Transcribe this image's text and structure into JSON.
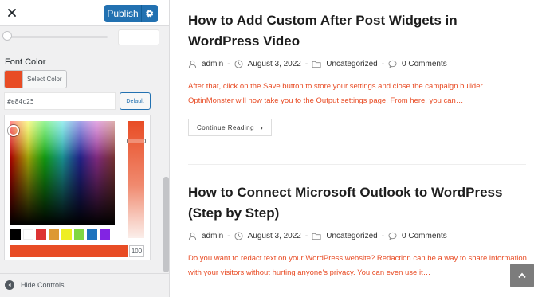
{
  "panel": {
    "publish_label": "Publish",
    "slider_value": "",
    "font_color": {
      "label": "Font Color",
      "select_label": "Select Color",
      "hex_value": "#e84c25",
      "default_label": "Default",
      "alpha_value": "100",
      "current_color": "#e84c25",
      "palettes": [
        "#000000",
        "#ffffff",
        "#dd3333",
        "#dd9933",
        "#eeee22",
        "#81d742",
        "#1e73be",
        "#8224e3"
      ]
    },
    "hide_controls_label": "Hide Controls"
  },
  "posts": [
    {
      "title": "How to Add Custom After Post Widgets in WordPress Video",
      "author": "admin",
      "date": "August 3, 2022",
      "category": "Uncategorized",
      "comments": "0 Comments",
      "excerpt": "After that, click on the Save button to store your settings and close the campaign builder. OptinMonster will now take you to the Output settings page. From here, you can…",
      "continue_label": "Continue Reading"
    },
    {
      "title": "How to Connect Microsoft Outlook to WordPress (Step by Step)",
      "author": "admin",
      "date": "August 3, 2022",
      "category": "Uncategorized",
      "comments": "0 Comments",
      "excerpt": "Do you want to redact text on your WordPress website? Redaction can be a way to share information with your visitors without hurting anyone's privacy. You can even use it…"
    }
  ],
  "colors": {
    "accent": "#2271b1",
    "excerpt_text": "#e84c25"
  }
}
